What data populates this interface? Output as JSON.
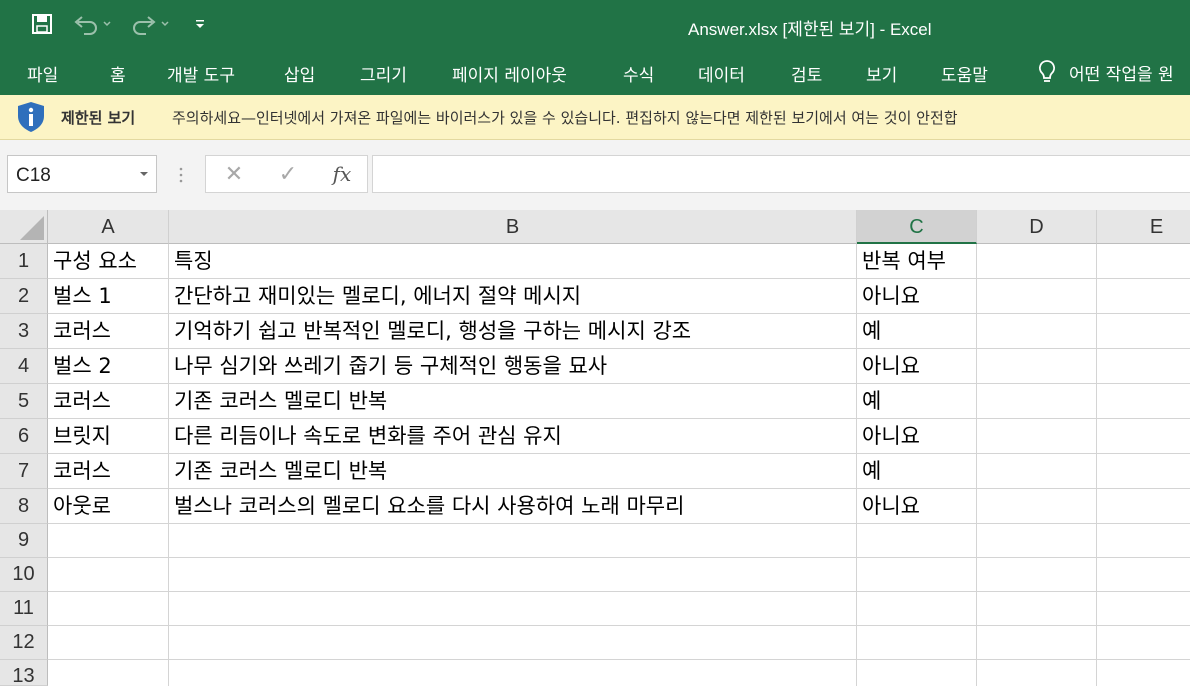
{
  "window": {
    "title": "Answer.xlsx  [제한된 보기]  -  Excel",
    "quick_access": [
      "save-icon",
      "undo-icon",
      "redo-icon",
      "customize-icon"
    ],
    "theme_color": "#217346"
  },
  "ribbon": {
    "tabs": [
      "파일",
      "홈",
      "개발 도구",
      "삽입",
      "그리기",
      "페이지 레이아웃",
      "수식",
      "데이터",
      "검토",
      "보기",
      "도움말"
    ],
    "tell_me": "어떤 작업을 원"
  },
  "message_bar": {
    "icon": "info-shield-icon",
    "title": "제한된 보기",
    "text": "주의하세요—인터넷에서 가져온 파일에는 바이러스가 있을 수 있습니다. 편집하지 않는다면 제한된 보기에서 여는 것이 안전합"
  },
  "formula_bar": {
    "name_box": "C18",
    "cancel": "✕",
    "enter": "✓",
    "fx": "fx",
    "value": ""
  },
  "sheet": {
    "columns": [
      "A",
      "B",
      "C",
      "D",
      "E"
    ],
    "selected_column": "C",
    "row_numbers": [
      "1",
      "2",
      "3",
      "4",
      "5",
      "6",
      "7",
      "8",
      "9",
      "10",
      "11",
      "12",
      "13"
    ],
    "rows": [
      [
        "구성 요소",
        "특징",
        "반복 여부"
      ],
      [
        "벌스 1",
        "간단하고 재미있는 멜로디, 에너지 절약 메시지",
        "아니요"
      ],
      [
        "코러스",
        "기억하기 쉽고 반복적인 멜로디, 행성을 구하는 메시지 강조",
        "예"
      ],
      [
        "벌스 2",
        "나무 심기와 쓰레기 줍기 등 구체적인 행동을 묘사",
        "아니요"
      ],
      [
        "코러스",
        "기존 코러스 멜로디 반복",
        "예"
      ],
      [
        "브릿지",
        "다른 리듬이나 속도로 변화를 주어 관심 유지",
        "아니요"
      ],
      [
        "코러스",
        "기존 코러스 멜로디 반복",
        "예"
      ],
      [
        "아웃로",
        "벌스나 코러스의 멜로디 요소를 다시 사용하여 노래 마무리",
        "아니요"
      ]
    ]
  }
}
